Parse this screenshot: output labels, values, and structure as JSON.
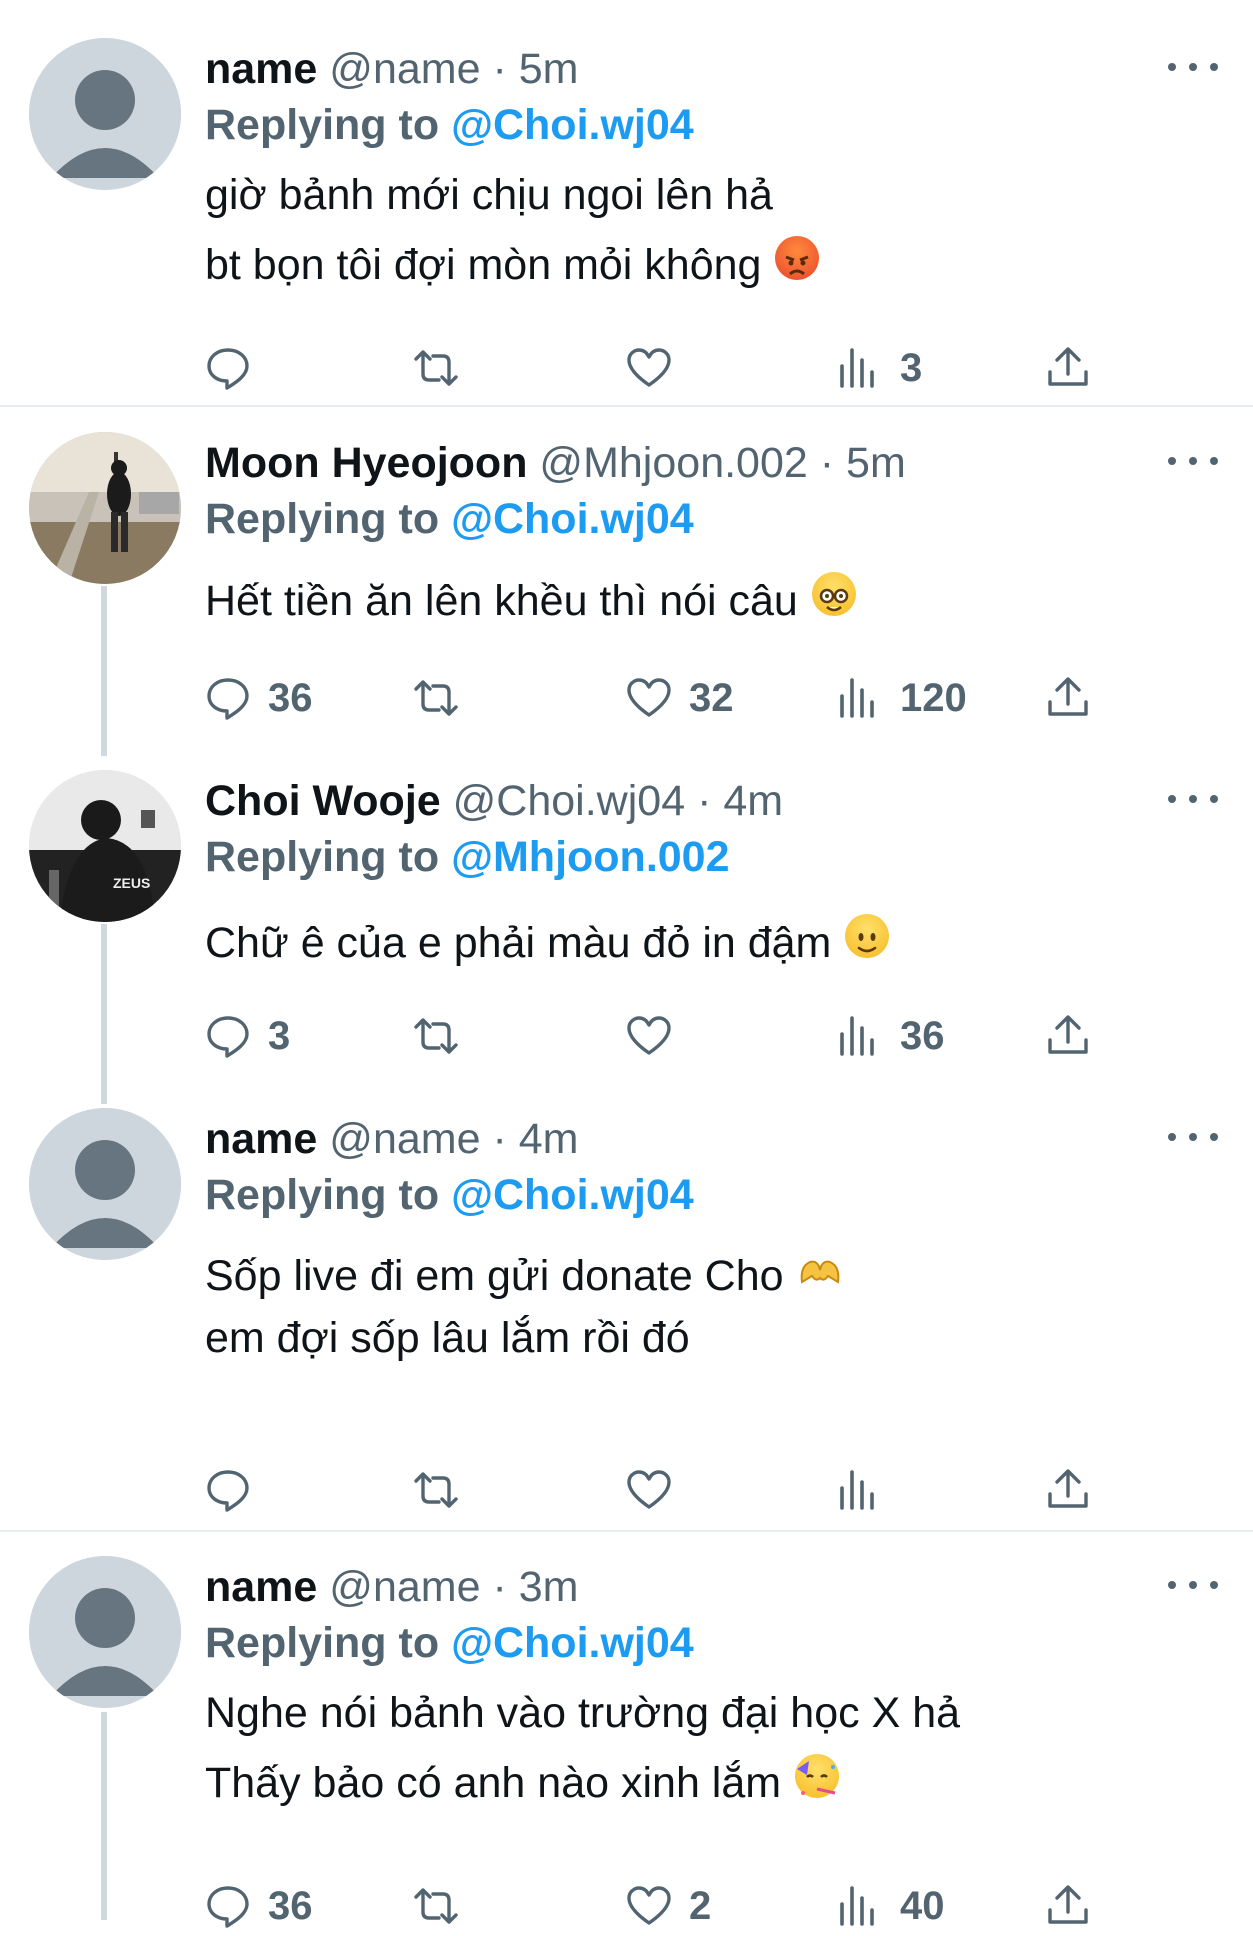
{
  "tweets": [
    {
      "name": "name",
      "handle": "@name",
      "time": "5m",
      "replying_label": "Replying to",
      "replying_to": "@Choi.wj04",
      "lines": [
        "giờ bảnh mới chịu ngoi lên hả",
        "bt bọn tôi đợi mòn mỏi không"
      ],
      "emoji": "angry-face",
      "counts": {
        "reply": "",
        "retweet": "",
        "like": "",
        "views": "3"
      }
    },
    {
      "name": "Moon Hyeojoon",
      "handle": "@Mhjoon.002",
      "time": "5m",
      "replying_label": "Replying to",
      "replying_to": "@Choi.wj04",
      "lines": [
        "Hết tiền ăn lên khều thì nói câu"
      ],
      "emoji": "nerd-face",
      "counts": {
        "reply": "36",
        "retweet": "",
        "like": "32",
        "views": "120"
      }
    },
    {
      "name": "Choi Wooje",
      "handle": "@Choi.wj04",
      "time": "4m",
      "replying_label": "Replying to",
      "replying_to": "@Mhjoon.002",
      "lines": [
        "Chữ ê của e phải màu đỏ in đậm"
      ],
      "emoji": "slightly-smiling-face",
      "counts": {
        "reply": "3",
        "retweet": "",
        "like": "",
        "views": "36"
      }
    },
    {
      "name": "name",
      "handle": "@name",
      "time": "4m",
      "replying_label": "Replying to",
      "replying_to": "@Choi.wj04",
      "lines": [
        "Sốp live đi em gửi donate Cho",
        "em đợi sốp lâu lắm rồi đó"
      ],
      "emoji": "heart-hands",
      "counts": {
        "reply": "",
        "retweet": "",
        "like": "",
        "views": ""
      }
    },
    {
      "name": "name",
      "handle": "@name",
      "time": "3m",
      "replying_label": "Replying to",
      "replying_to": "@Choi.wj04",
      "lines": [
        "Nghe nói bảnh vào trường đại học X hả",
        "Thấy bảo có anh nào xinh lắm"
      ],
      "emoji": "partying-face",
      "counts": {
        "reply": "36",
        "retweet": "",
        "like": "2",
        "views": "40"
      }
    }
  ],
  "colors": {
    "accent": "#1d9bf0",
    "muted": "#536471",
    "text": "#0f1419"
  }
}
